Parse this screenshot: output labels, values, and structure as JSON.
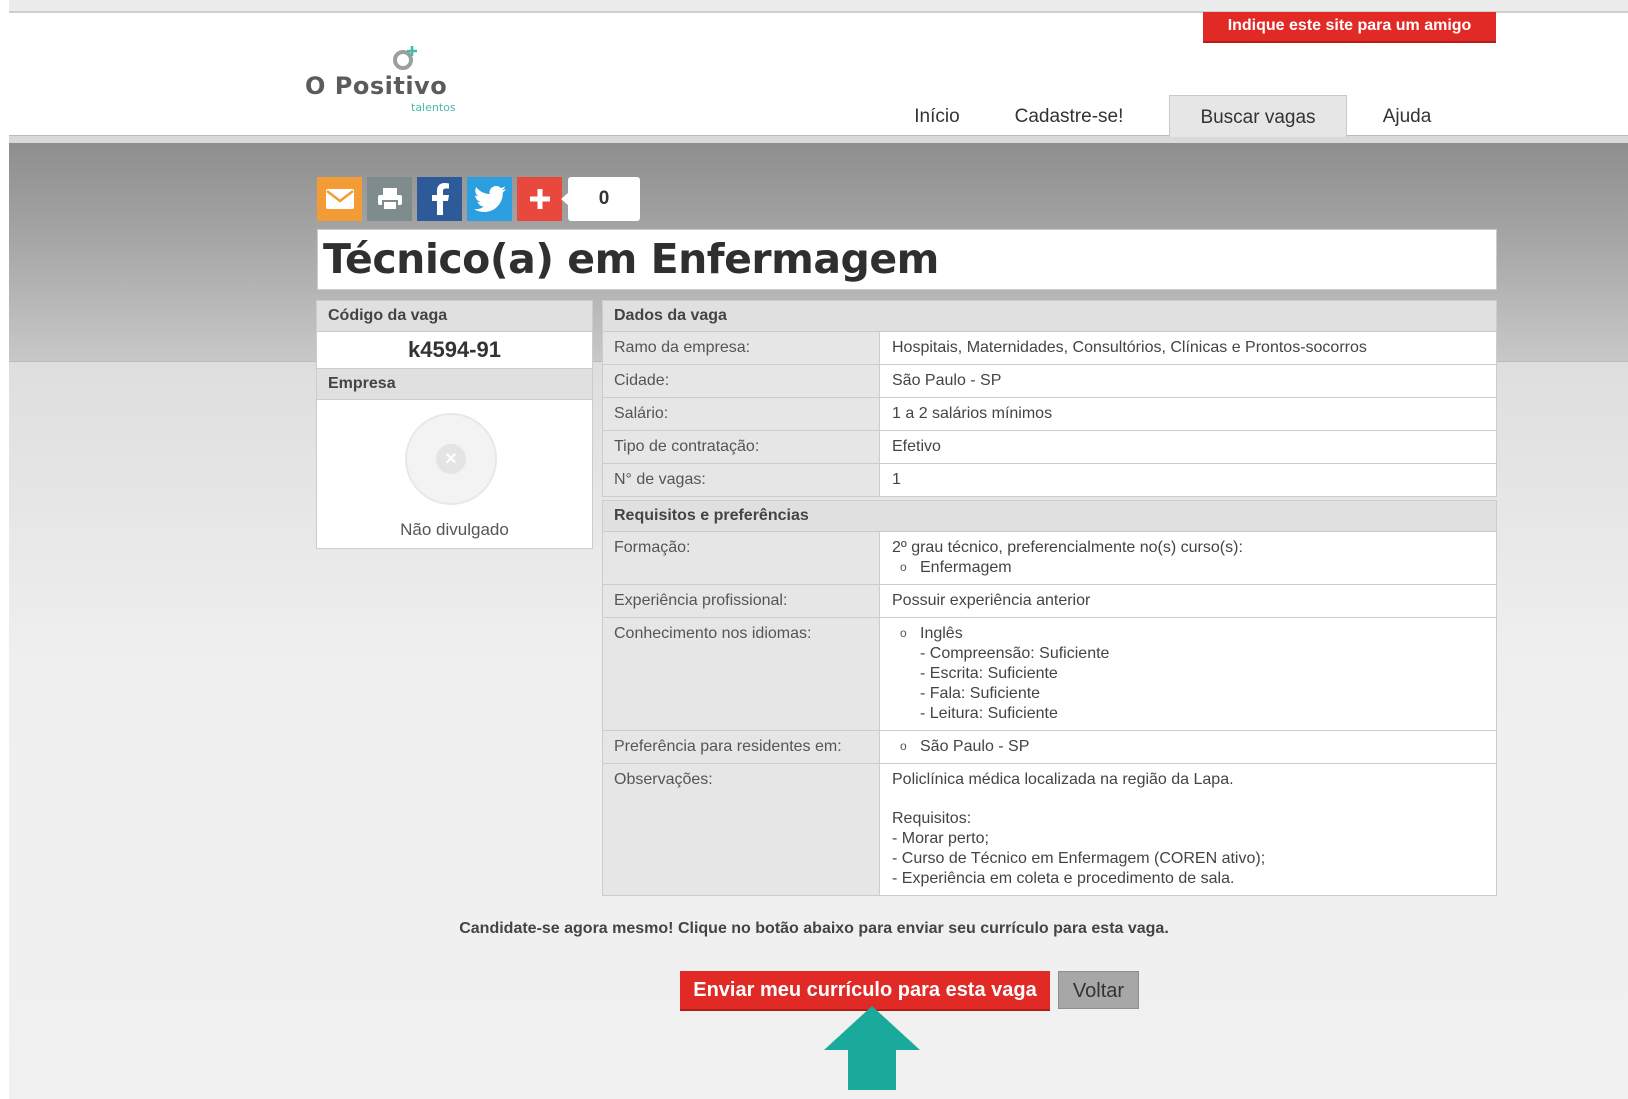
{
  "header": {
    "logo_name": "O Positivo",
    "logo_sub": "talentos",
    "indique_label": "Indique este site para um amigo",
    "nav": [
      "Início",
      "Cadastre-se!",
      "Buscar vagas",
      "Ajuda"
    ],
    "active_nav": "Buscar vagas"
  },
  "share": {
    "icons": [
      "email-icon",
      "print-icon",
      "facebook-icon",
      "twitter-icon",
      "plus-icon"
    ],
    "colors": [
      "#f39c35",
      "#7f8c8d",
      "#2d5b9a",
      "#2b9fe0",
      "#e8493c"
    ],
    "count": "0"
  },
  "job": {
    "title": "Técnico(a) em Enfermagem",
    "code_header": "Código da vaga",
    "code": "k4594-91",
    "company_header": "Empresa",
    "company": "Não divulgado"
  },
  "dados": {
    "header": "Dados da vaga",
    "rows": [
      {
        "label": "Ramo da empresa:",
        "value": "Hospitais, Maternidades, Consultórios, Clínicas e Prontos-socorros"
      },
      {
        "label": "Cidade:",
        "value": "São Paulo - SP"
      },
      {
        "label": "Salário:",
        "value": "1 a 2 salários mínimos"
      },
      {
        "label": "Tipo de contratação:",
        "value": "Efetivo"
      },
      {
        "label": "N° de vagas:",
        "value": "1"
      }
    ]
  },
  "requisitos": {
    "header": "Requisitos e preferências",
    "formacao_label": "Formação:",
    "formacao_value": "2º grau técnico, preferencialmente no(s) curso(s):",
    "formacao_item": "Enfermagem",
    "experiencia_label": "Experiência profissional:",
    "experiencia_value": "Possuir experiência anterior",
    "idiomas_label": "Conhecimento nos idiomas:",
    "idioma": "Inglês",
    "idioma_detalhes": [
      "- Compreensão: Suficiente",
      "- Escrita: Suficiente",
      "- Fala: Suficiente",
      "- Leitura: Suficiente"
    ],
    "residentes_label": "Preferência para residentes em:",
    "residentes_value": "São Paulo - SP",
    "obs_label": "Observações:",
    "obs_intro": "Policlínica médica localizada na região da Lapa.",
    "obs_lines": [
      "Requisitos:",
      "- Morar perto;",
      "- Curso de Técnico em Enfermagem (COREN ativo);",
      "- Experiência em coleta e procedimento de sala."
    ]
  },
  "cta": {
    "text": "Candidate-se agora mesmo! Clique no botão abaixo para enviar seu currículo para esta vaga.",
    "send_label": "Enviar meu currículo para esta vaga",
    "back_label": "Voltar",
    "arrow_color": "#1aaa9b"
  }
}
